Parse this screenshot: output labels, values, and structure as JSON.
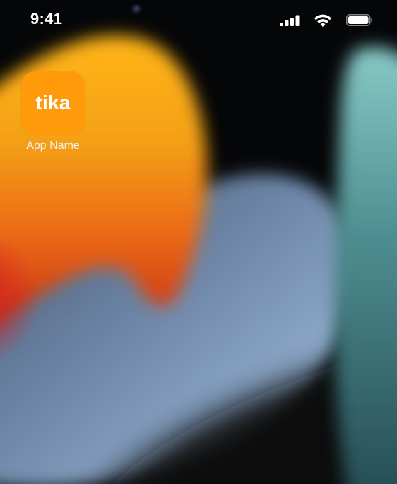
{
  "status_bar": {
    "time": "9:41",
    "signal_icon": "cellular-signal-icon",
    "wifi_icon": "wifi-icon",
    "battery_icon": "battery-full-icon"
  },
  "home_screen": {
    "apps": [
      {
        "icon_text": "tika",
        "label": "App Name",
        "icon_color": "#ff9a0b"
      }
    ]
  },
  "colors": {
    "wallpaper_orange": "#f4a012",
    "wallpaper_red": "#d0331c",
    "wallpaper_blue_gray": "#7f9ab8",
    "wallpaper_teal": "#4f8f92",
    "background": "#050608"
  }
}
